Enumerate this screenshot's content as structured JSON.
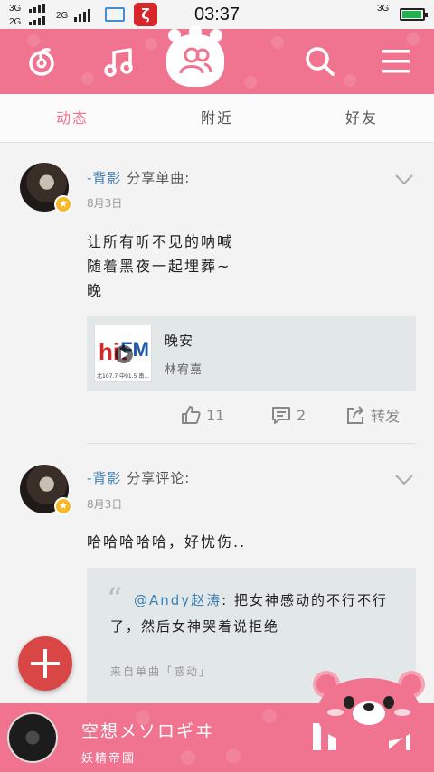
{
  "status_bar": {
    "sim1_top": "3G",
    "sim1_bottom": "2G",
    "sim2": "2G",
    "time": "03:37",
    "net_right": "3G",
    "app_badge": "ζ"
  },
  "header": {
    "icons": [
      "netease-logo-icon",
      "music-note-icon",
      "friends-paw-icon",
      "search-icon",
      "menu-icon"
    ],
    "accent": "#f0738f"
  },
  "tabs": [
    {
      "label": "动态",
      "active": true
    },
    {
      "label": "附近",
      "active": false
    },
    {
      "label": "好友",
      "active": false
    }
  ],
  "posts": [
    {
      "user": "-背影",
      "action": "分享单曲:",
      "date": "8月3日",
      "text": "让所有听不见的呐喊\n随着黑夜一起埋葬~\n晚",
      "song": {
        "title": "晚安",
        "artist": "林宥嘉",
        "cover_brand": "hit",
        "cover_fm": "FM",
        "cover_freq": "北107.7 中91.5 南..."
      },
      "likes": "11",
      "comments": "2",
      "share_label": "转发"
    },
    {
      "user": "-背影",
      "action": "分享评论:",
      "date": "8月3日",
      "text": "哈哈哈哈哈，好忧伤..",
      "quote": {
        "mention": "@Andy赵涛",
        "body": ": 把女神感动的不行不行了，然后女神哭着说拒绝",
        "source": "来自单曲「感动」"
      }
    }
  ],
  "player": {
    "title": "空想メソロギヰ",
    "artist": "妖精帝國"
  }
}
